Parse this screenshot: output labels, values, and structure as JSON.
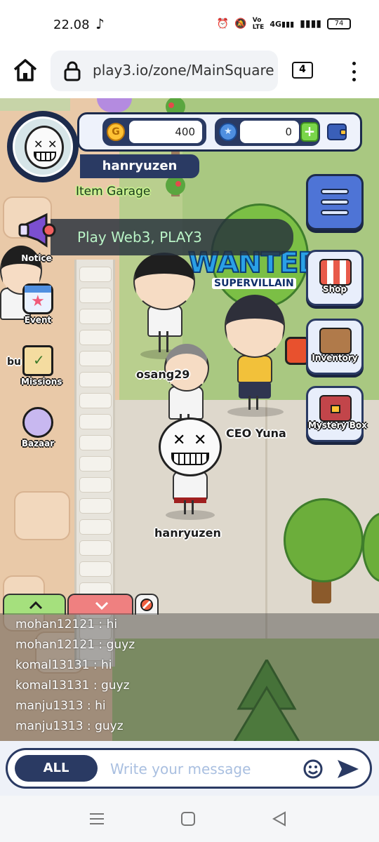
{
  "status_bar": {
    "time": "22.08",
    "battery": "74"
  },
  "browser": {
    "url": "play3.io/zone/MainSquare",
    "tab_count": "4"
  },
  "hud": {
    "username": "hanryuzen",
    "coins": "400",
    "gems": "0",
    "item_garage": "Item Garage"
  },
  "announcement": "Play Web3, PLAY3",
  "left_menu": [
    {
      "label": "Notice",
      "icon": "megaphone-icon"
    },
    {
      "label": "Event",
      "icon": "calendar-star-icon"
    },
    {
      "label": "Missions",
      "icon": "scroll-icon"
    },
    {
      "label": "Bazaar",
      "icon": "bazaar-icon"
    }
  ],
  "right_menu": [
    {
      "label": "Shop",
      "icon": "shop-icon"
    },
    {
      "label": "Inventory",
      "icon": "briefcase-icon"
    },
    {
      "label": "Mystery Box",
      "icon": "treasure-chest-icon"
    }
  ],
  "world": {
    "sign_main": "WANTED",
    "sign_sub": "SUPERVILLAIN",
    "left_edge_text": "bu",
    "characters": [
      "osang29",
      "CEO Yuna",
      "hanryuzen"
    ]
  },
  "chat": {
    "messages": [
      {
        "user": "mohan12121",
        "text": "hi"
      },
      {
        "user": "mohan12121",
        "text": "guyz"
      },
      {
        "user": "komal13131",
        "text": "hi"
      },
      {
        "user": "komal13131",
        "text": "guyz"
      },
      {
        "user": "manju1313",
        "text": "hi"
      },
      {
        "user": "manju1313",
        "text": "guyz"
      }
    ],
    "channel": "ALL",
    "placeholder": "Write your message"
  },
  "colors": {
    "hud_navy": "#2a3a63",
    "coin_gold": "#ffc235",
    "gem_blue": "#4f8fe0",
    "announce_text": "#b9f3c6"
  }
}
